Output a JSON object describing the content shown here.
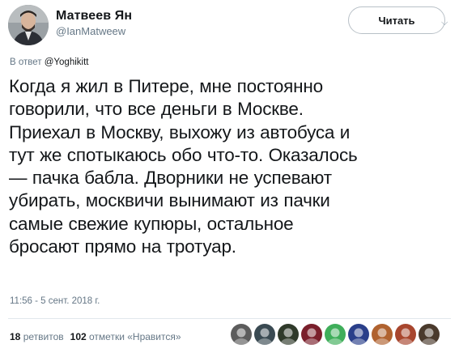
{
  "author": {
    "display_name": "Матвеев Ян",
    "handle": "@IanMatweew"
  },
  "follow_button": {
    "label": "Читать"
  },
  "more_menu_icon": "chevron-down-icon",
  "reply_to": {
    "prefix": "В ответ",
    "mention": "@Yoghikitt"
  },
  "tweet": {
    "lines": [
      "Когда я жил в Питере, мне постоянно",
      "говорили, что все деньги в Москве.",
      "Приехал в Москву, выхожу из автобуса и",
      "тут же спотыкаюсь обо что-то. Оказалось",
      "— пачка бабла. Дворники не успевают",
      "убирать, москвичи вынимают из пачки",
      "самые свежие купюры, остальное",
      "бросают прямо на тротуар."
    ],
    "timestamp": "11:56 - 5 сент. 2018 г."
  },
  "stats": {
    "retweets_count": "18",
    "retweets_label": "ретвитов",
    "likes_count": "102",
    "likes_label": "отметки «Нравится»"
  },
  "likers": [
    {
      "name": "liker-avatar-1",
      "color": "#5c5c5c"
    },
    {
      "name": "liker-avatar-2",
      "color": "#3a4a52"
    },
    {
      "name": "liker-avatar-3",
      "color": "#2f3a2a"
    },
    {
      "name": "liker-avatar-4",
      "color": "#7a1f2b"
    },
    {
      "name": "liker-avatar-5",
      "color": "#3fae5a"
    },
    {
      "name": "liker-avatar-6",
      "color": "#2a3f8a"
    },
    {
      "name": "liker-avatar-7",
      "color": "#b0622f"
    },
    {
      "name": "liker-avatar-8",
      "color": "#a8462e"
    },
    {
      "name": "liker-avatar-9",
      "color": "#4a3a2c"
    }
  ],
  "colors": {
    "text": "#14171a",
    "secondary": "#657786",
    "border": "#e1e8ed"
  }
}
